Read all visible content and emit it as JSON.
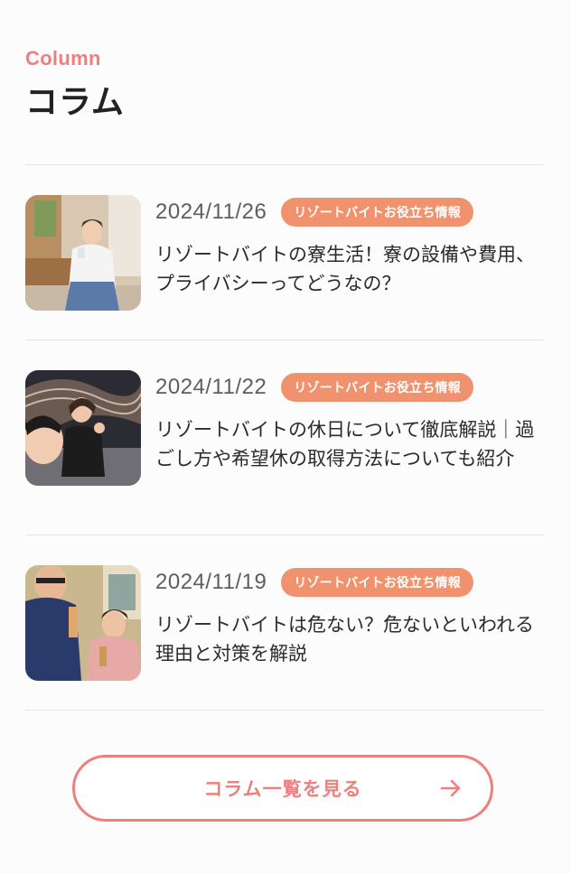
{
  "section": {
    "eyebrow": "Column",
    "title": "コラム"
  },
  "articles": [
    {
      "date": "2024/11/26",
      "category": "リゾートバイトお役立ち情報",
      "title": "リゾートバイトの寮生活！寮の設備や費用、プライバシーってどうなの？"
    },
    {
      "date": "2024/11/22",
      "category": "リゾートバイトお役立ち情報",
      "title": "リゾートバイトの休日について徹底解説｜過ごし方や希望休の取得方法についても紹介"
    },
    {
      "date": "2024/11/19",
      "category": "リゾートバイトお役立ち情報",
      "title": "リゾートバイトは危ない？危ないといわれる理由と対策を解説"
    }
  ],
  "more_button": {
    "label": "コラム一覧を見る",
    "icon": "arrow-right-icon"
  },
  "colors": {
    "accent": "#ee7f7f",
    "badge": "#f0926e"
  }
}
